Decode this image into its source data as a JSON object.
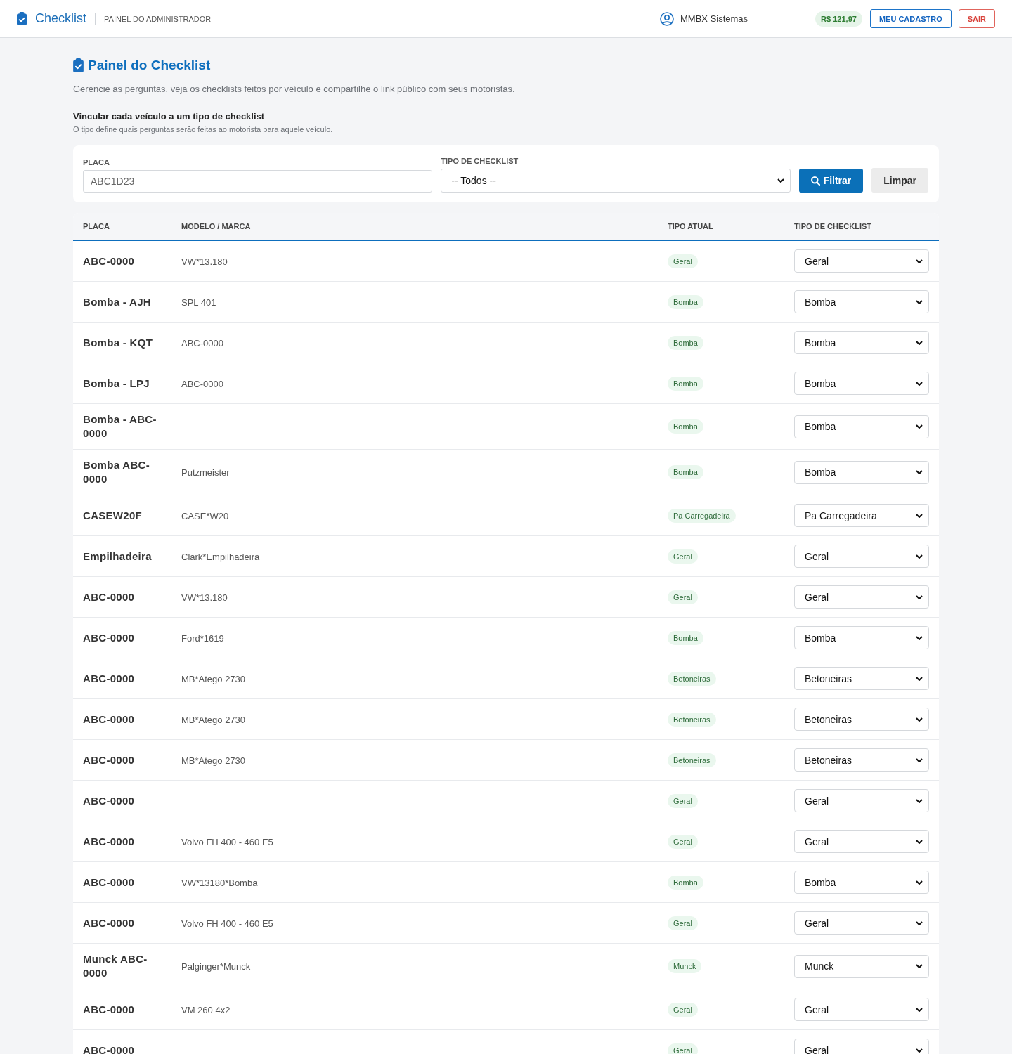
{
  "header": {
    "brand": "Checklist",
    "subtitle": "PAINEL DO ADMINISTRADOR",
    "user": "MMBX Sistemas",
    "balance": "R$ 121,97",
    "buttons": [
      {
        "label": "MEU CADASTRO",
        "kind": "primary"
      },
      {
        "label": "SAIR",
        "kind": "danger"
      }
    ]
  },
  "page": {
    "title": "Painel do Checklist",
    "description": "Gerencie as perguntas, veja os checklists feitos por veículo e compartilhe o link público com seus motoristas.",
    "section_title": "Vincular cada veículo a um tipo de checklist",
    "section_hint": "O tipo define quais perguntas serão feitas ao motorista para aquele veículo."
  },
  "filters": {
    "fields": [
      {
        "label": "PLACA",
        "kind": "input",
        "placeholder": "ABC1D23"
      },
      {
        "label": "TIPO DE CHECKLIST",
        "kind": "select",
        "value": "-- Todos --"
      }
    ],
    "buttons": [
      {
        "label": "Filtrar",
        "kind": "primary"
      },
      {
        "label": "Limpar",
        "kind": "secondary"
      }
    ]
  },
  "table": {
    "columns": [
      "PLACA",
      "MODELO / MARCA",
      "TIPO ATUAL",
      "TIPO DE CHECKLIST"
    ],
    "rows": [
      {
        "placa": "ABC-0000",
        "modelo": "VW*13.180",
        "tipo_atual": "Geral",
        "tipo_checklist": "Geral"
      },
      {
        "placa": "Bomba - AJH",
        "modelo": "SPL 401",
        "tipo_atual": "Bomba",
        "tipo_checklist": "Bomba"
      },
      {
        "placa": "Bomba - KQT",
        "modelo": "ABC-0000",
        "tipo_atual": "Bomba",
        "tipo_checklist": "Bomba"
      },
      {
        "placa": "Bomba - LPJ",
        "modelo": "ABC-0000",
        "tipo_atual": "Bomba",
        "tipo_checklist": "Bomba"
      },
      {
        "placa": "Bomba - ABC-0000",
        "tipo_atual": "Bomba",
        "tipo_checklist": "Bomba"
      },
      {
        "placa": "Bomba ABC-0000",
        "modelo": "Putzmeister",
        "tipo_atual": "Bomba",
        "tipo_checklist": "Bomba"
      },
      {
        "placa": "CASEW20F",
        "modelo": "CASE*W20",
        "tipo_atual": "Pa Carregadeira",
        "tipo_checklist": "Pa Carregadeira"
      },
      {
        "placa": "Empilhadeira",
        "modelo": "Clark*Empilhadeira",
        "tipo_atual": "Geral",
        "tipo_checklist": "Geral"
      },
      {
        "placa": "ABC-0000",
        "modelo": "VW*13.180",
        "tipo_atual": "Geral",
        "tipo_checklist": "Geral"
      },
      {
        "placa": "ABC-0000",
        "modelo": "Ford*1619",
        "tipo_atual": "Bomba",
        "tipo_checklist": "Bomba"
      },
      {
        "placa": "ABC-0000",
        "modelo": "MB*Atego 2730",
        "tipo_atual": "Betoneiras",
        "tipo_checklist": "Betoneiras"
      },
      {
        "placa": "ABC-0000",
        "modelo": "MB*Atego 2730",
        "tipo_atual": "Betoneiras",
        "tipo_checklist": "Betoneiras"
      },
      {
        "placa": "ABC-0000",
        "modelo": "MB*Atego 2730",
        "tipo_atual": "Betoneiras",
        "tipo_checklist": "Betoneiras"
      },
      {
        "placa": "ABC-0000",
        "tipo_atual": "Geral",
        "tipo_checklist": "Geral"
      },
      {
        "placa": "ABC-0000",
        "modelo": "Volvo FH 400 - 460 E5",
        "tipo_atual": "Geral",
        "tipo_checklist": "Geral"
      },
      {
        "placa": "ABC-0000",
        "modelo": "VW*13180*Bomba",
        "tipo_atual": "Bomba",
        "tipo_checklist": "Bomba"
      },
      {
        "placa": "ABC-0000",
        "modelo": "Volvo FH 400 - 460 E5",
        "tipo_atual": "Geral",
        "tipo_checklist": "Geral"
      },
      {
        "placa": "Munck ABC-0000",
        "modelo": "Palginger*Munck",
        "tipo_atual": "Munck",
        "tipo_checklist": "Munck"
      },
      {
        "placa": "ABC-0000",
        "modelo": "VM 260 4x2",
        "tipo_atual": "Geral",
        "tipo_checklist": "Geral"
      },
      {
        "placa": "ABC-0000",
        "tipo_atual": "Geral",
        "tipo_checklist": "Geral"
      }
    ]
  }
}
